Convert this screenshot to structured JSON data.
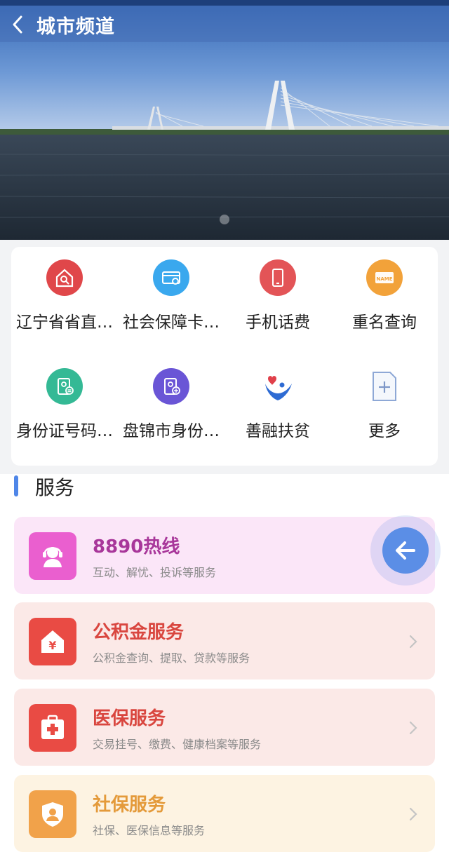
{
  "header": {
    "title": "城市频道",
    "back_icon": "chevron-left-icon"
  },
  "banner": {
    "image": "cable-stayed bridge over river",
    "slide_count": 1,
    "active_slide": 1
  },
  "quick_services": [
    {
      "label": "辽宁省省直…",
      "icon": "house-search-icon",
      "color": "#e0474a"
    },
    {
      "label": "社会保障卡…",
      "icon": "card-icon",
      "color": "#3aa8ee"
    },
    {
      "label": "手机话费",
      "icon": "phone-icon",
      "color": "#e35457"
    },
    {
      "label": "重名查询",
      "icon": "name-card-icon",
      "color": "#f2a23a"
    },
    {
      "label": "身份证号码…",
      "icon": "id-card-list-icon",
      "color": "#34b995"
    },
    {
      "label": "盘锦市身份…",
      "icon": "id-card-search-icon",
      "color": "#6a55d6"
    },
    {
      "label": "善融扶贫",
      "icon": "heart-hands-icon",
      "color": "#2e6bd3"
    },
    {
      "label": "更多",
      "icon": "more-plus-icon",
      "color": "#7ea0d8"
    }
  ],
  "section": {
    "title": "服务"
  },
  "services": [
    {
      "title": "8890热线",
      "subtitle": "互动、解忧、投诉等服务",
      "icon": "headset-agent-icon",
      "bg": "#fbe6f8",
      "icon_bg": "#ea5fcf",
      "title_color": "#a8379a"
    },
    {
      "title": "公积金服务",
      "subtitle": "公积金查询、提取、贷款等服务",
      "icon": "house-yuan-icon",
      "bg": "#fbe9e7",
      "icon_bg": "#e94b44",
      "title_color": "#d9463f"
    },
    {
      "title": "医保服务",
      "subtitle": "交易挂号、缴费、健康档案等服务",
      "icon": "medical-kit-icon",
      "bg": "#fbe9e7",
      "icon_bg": "#e94b44",
      "title_color": "#d9463f"
    },
    {
      "title": "社保服务",
      "subtitle": "社保、医保信息等服务",
      "icon": "shield-user-icon",
      "bg": "#fdf3e2",
      "icon_bg": "#f1a24a",
      "title_color": "#e49a3a"
    }
  ],
  "floating_button": {
    "icon": "arrow-left-icon"
  }
}
